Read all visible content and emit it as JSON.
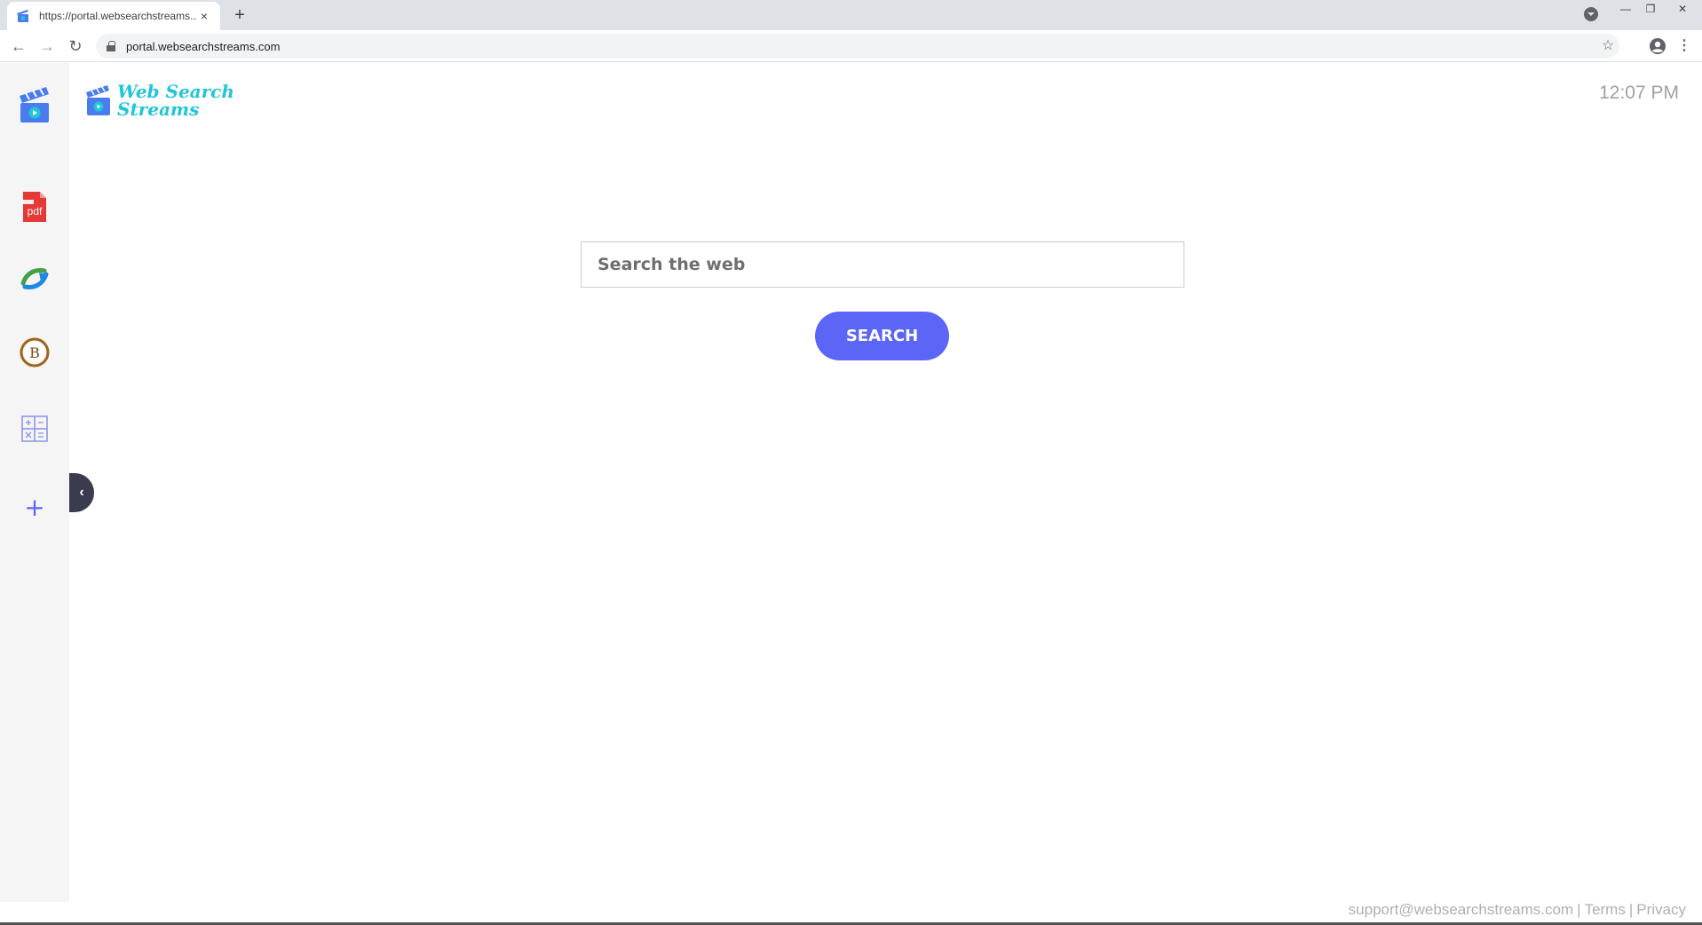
{
  "browser": {
    "tab_title": "https://portal.websearchstreams...",
    "tab_close": "×",
    "new_tab": "+",
    "url": "portal.websearchstreams.com",
    "back": "←",
    "forward": "→",
    "reload": "↻",
    "star": "☆",
    "menu": "⋮",
    "minimize": "—",
    "restore": "❐",
    "close": "✕"
  },
  "header": {
    "logo_line1": "Web Search",
    "logo_line2": "Streams",
    "time": "12:07 PM"
  },
  "sidebar": {
    "items": [
      {
        "name": "streams-app",
        "icon": "clapperboard-icon"
      },
      {
        "name": "pdf-app",
        "label": "pdf",
        "icon": "pdf-icon"
      },
      {
        "name": "converter-app",
        "icon": "arrows-icon"
      },
      {
        "name": "bitcoin-app",
        "label": "B",
        "icon": "bitcoin-icon"
      },
      {
        "name": "calculator-app",
        "icon": "calculator-icon"
      },
      {
        "name": "add-app",
        "label": "+",
        "icon": "plus-icon"
      }
    ],
    "collapse": "‹"
  },
  "search": {
    "placeholder": "Search the web",
    "button_label": "SEARCH"
  },
  "footer": {
    "email": "support@websearchstreams.com",
    "sep1": "|",
    "terms": "Terms",
    "sep2": "|",
    "privacy": "Privacy"
  },
  "colors": {
    "accent": "#5b66f6",
    "logo": "#21c5d8"
  }
}
